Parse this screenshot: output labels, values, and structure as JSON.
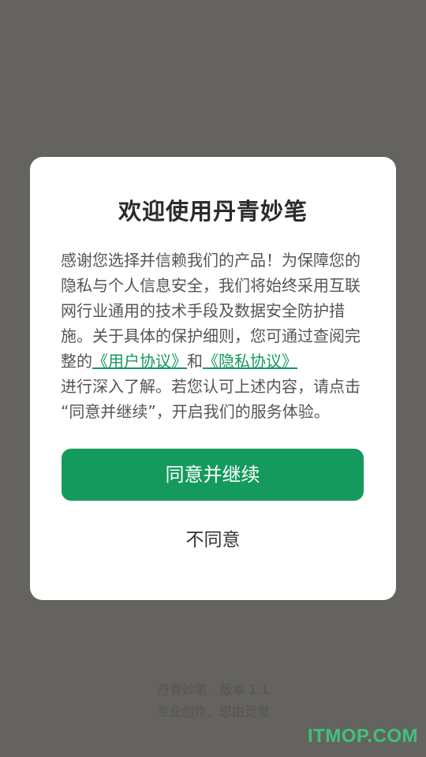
{
  "dialog": {
    "title": "欢迎使用丹青妙笔",
    "body_part1": "感谢您选择并信赖我们的产品！为保障您的隐私与个人信息安全，我们将始终采用互联网行业通用的技术手段及数据安全防护措施。关于具体的保护细则，您可通过查阅完整的",
    "user_agreement_link": "《用户协议》",
    "and_text": "和",
    "privacy_policy_link": "《隐私协议》",
    "body_part2": "进行深入了解。若您认可上述内容，请点击 “同意并继续”，开启我们的服务体验。",
    "agree_label": "同意并继续",
    "disagree_label": "不同意"
  },
  "footer": {
    "version": "丹青妙笔 · 版本 1.1",
    "slogan": "专业创作，思由灵觉"
  },
  "watermark": "ITMOP.COM",
  "colors": {
    "overlay": "#65635f",
    "accent": "#159a5d",
    "dialog_background": "#ffffff"
  }
}
